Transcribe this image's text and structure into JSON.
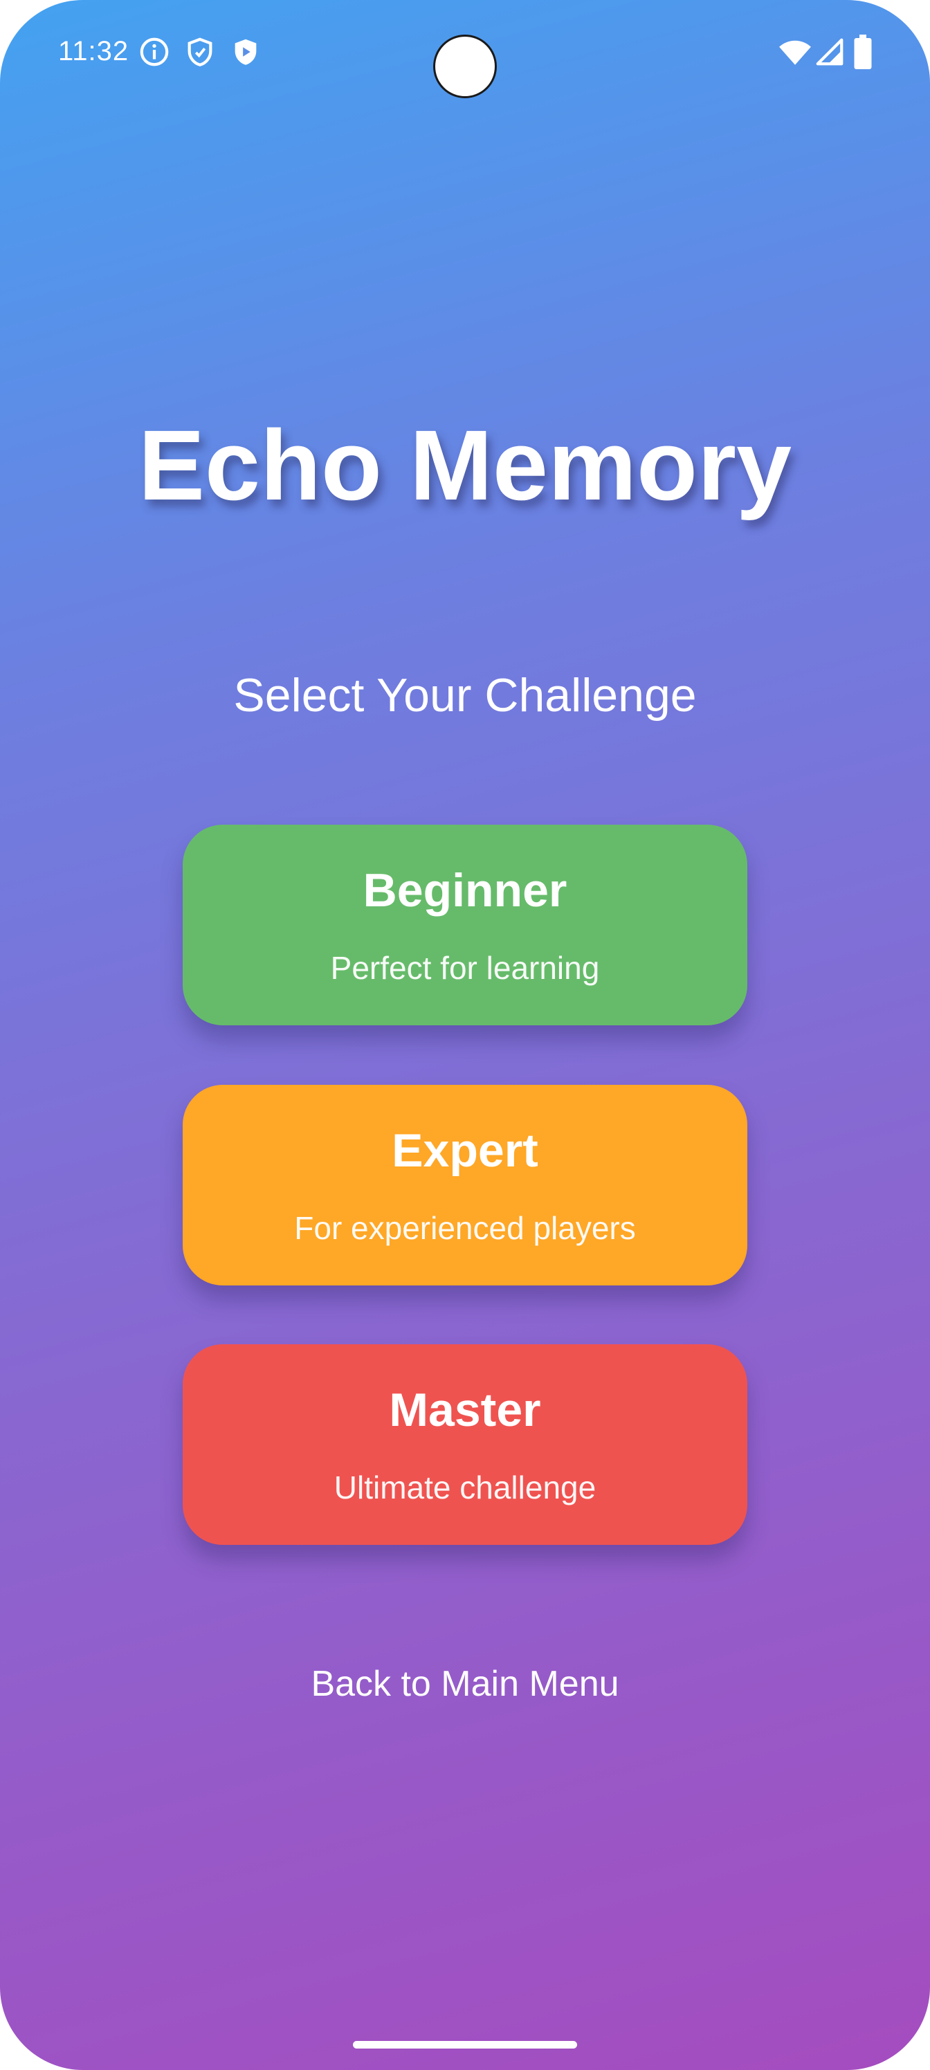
{
  "status_bar": {
    "time": "11:32",
    "left_icons": [
      "info-icon",
      "shield-icon",
      "play-shield-icon"
    ],
    "right_icons": [
      "wifi-icon",
      "cellular-signal-icon",
      "battery-icon"
    ]
  },
  "app": {
    "title": "Echo Memory",
    "subtitle": "Select Your Challenge"
  },
  "difficulties": [
    {
      "name": "Beginner",
      "description": "Perfect for learning",
      "color": "#66bb6a"
    },
    {
      "name": "Expert",
      "description": "For experienced players",
      "color": "#ffa726"
    },
    {
      "name": "Master",
      "description": "Ultimate challenge",
      "color": "#ef5350"
    }
  ],
  "back_label": "Back to Main Menu",
  "colors": {
    "gradient_start": "#44a2f1",
    "gradient_end": "#a54cbf"
  }
}
